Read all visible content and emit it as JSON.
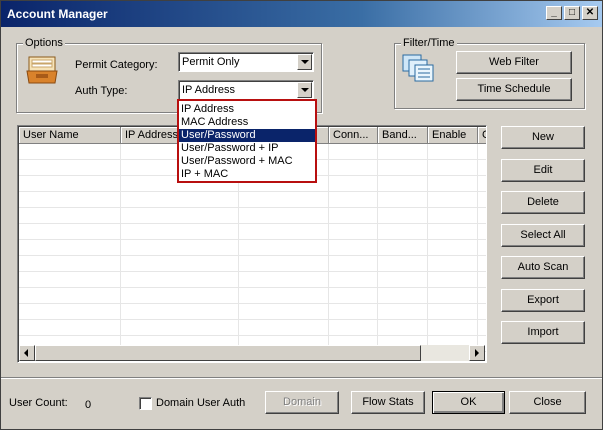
{
  "window": {
    "title": "Account Manager"
  },
  "options": {
    "group_label": "Options",
    "permit_category_label": "Permit Category:",
    "permit_category_value": "Permit Only",
    "auth_type_label": "Auth Type:",
    "auth_type_value": "IP Address"
  },
  "auth_dropdown": {
    "items": [
      "IP Address",
      "MAC Address",
      "User/Password",
      "User/Password + IP",
      "User/Password + MAC",
      "IP + MAC"
    ],
    "selected_index": 2
  },
  "filter": {
    "group_label": "Filter/Time",
    "web_filter_label": "Web Filter",
    "time_schedule_label": "Time Schedule"
  },
  "table": {
    "columns": [
      "User Name",
      "IP Address",
      "",
      "Conn...",
      "Band...",
      "Enable",
      "C"
    ]
  },
  "side_buttons": [
    "New",
    "Edit",
    "Delete",
    "Select All",
    "Auto Scan",
    "Export",
    "Import"
  ],
  "footer": {
    "user_count_label": "User Count:",
    "user_count_value": "0",
    "domain_user_auth_label": "Domain User Auth",
    "domain_label": "Domain",
    "flow_stats_label": "Flow Stats",
    "ok_label": "OK",
    "close_label": "Close"
  },
  "title_buttons": {
    "minimize": "_",
    "maximize": "□",
    "close": "✕"
  },
  "colors": {
    "title_start": "#0a246a",
    "title_end": "#a6caf0",
    "selection": "#0a246a",
    "dropdown_border": "#b80f0f"
  }
}
